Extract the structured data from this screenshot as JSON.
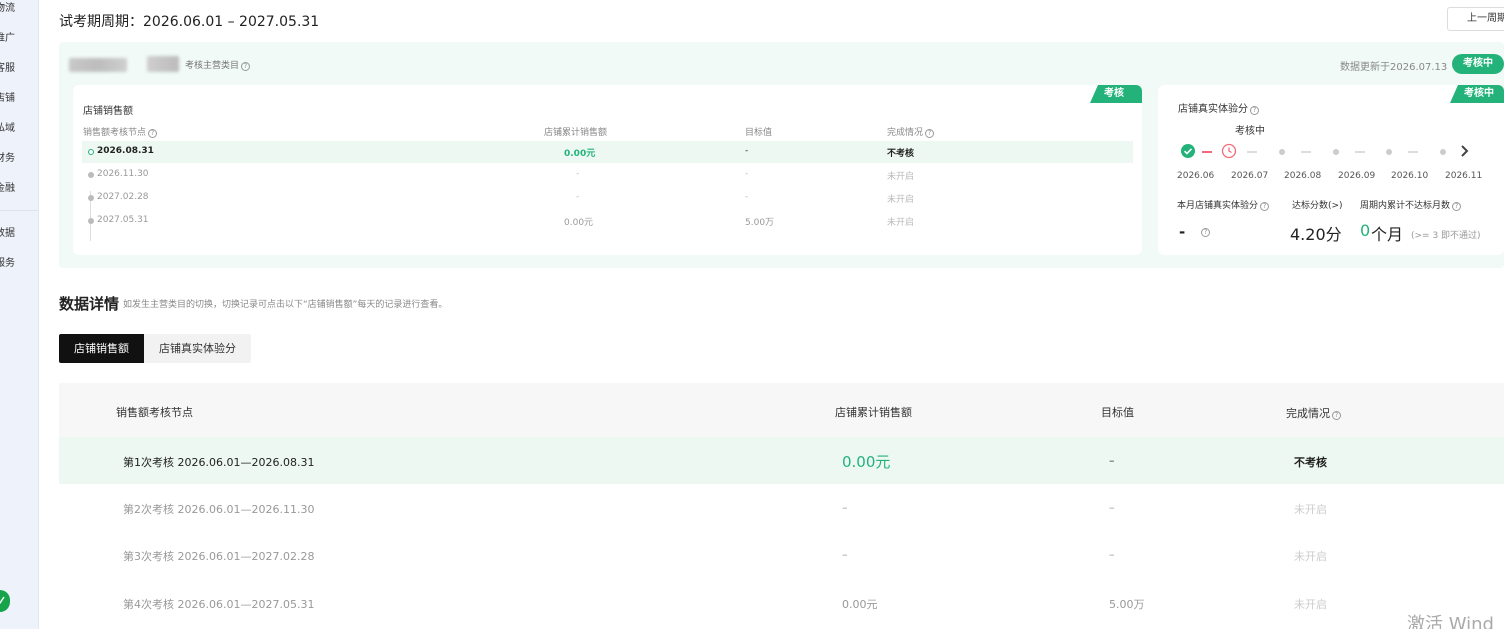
{
  "sidebar": {
    "items": [
      "物流",
      "推广",
      "客服",
      "店铺",
      "私域",
      "财务",
      "金融",
      "数据",
      "服务"
    ],
    "badge": ""
  },
  "header": {
    "period": "试考期周期：2026.06.01 – 2027.05.31",
    "prev_button": "上一周期"
  },
  "overview": {
    "category_label": "考核主营类目",
    "updated": "数据更新于2026.07.13",
    "status_pill": "考核中",
    "sales_card": {
      "tag": "考核中",
      "title": "店铺销售额",
      "headers": [
        "销售额考核节点",
        "店铺累计销售额",
        "目标值",
        "完成情况"
      ],
      "rows": [
        {
          "date": "2026.08.31",
          "sales": "0.00元",
          "target": "-",
          "status": "不考核"
        },
        {
          "date": "2026.11.30",
          "sales": "-",
          "target": "-",
          "status": "未开启"
        },
        {
          "date": "2027.02.28",
          "sales": "-",
          "target": "-",
          "status": "未开启"
        },
        {
          "date": "2027.05.31",
          "sales": "0.00元",
          "target": "5.00万",
          "status": "未开启"
        }
      ]
    },
    "score_card": {
      "tag": "考核中",
      "title": "店铺真实体验分",
      "status": "考核中",
      "months": [
        "2026.06",
        "2026.07",
        "2026.08",
        "2026.09",
        "2026.10",
        "2026.11"
      ],
      "labels": [
        "本月店铺真实体验分",
        "达标分数(>)",
        "周期内累计不达标月数"
      ],
      "current_score": "-",
      "threshold": "4.20分",
      "months_count": "0",
      "months_unit": "个月",
      "note": "(>= 3 即不通过)"
    }
  },
  "detail": {
    "title": "数据详情",
    "note": "如发生主营类目的切换，切换记录可点击以下“店铺销售额”每天的记录进行查看。",
    "tabs": [
      "店铺销售额",
      "店铺真实体验分"
    ],
    "headers": [
      "销售额考核节点",
      "店铺累计销售额",
      "目标值",
      "完成情况"
    ],
    "rows": [
      {
        "node": "第1次考核 2026.06.01—2026.08.31",
        "sales": "0.00元",
        "target": "–",
        "status": "不考核"
      },
      {
        "node": "第2次考核 2026.06.01—2026.11.30",
        "sales": "–",
        "target": "–",
        "status": "未开启"
      },
      {
        "node": "第3次考核 2026.06.01—2027.02.28",
        "sales": "–",
        "target": "–",
        "status": "未开启"
      },
      {
        "node": "第4次考核 2026.06.01—2027.05.31",
        "sales": "0.00元",
        "target": "5.00万",
        "status": "未开启"
      }
    ]
  },
  "watermark": "激活 Wind",
  "colors": {
    "accent": "#23b37a",
    "warning": "#f26b7c",
    "panel_bg": "#f1faf6"
  }
}
